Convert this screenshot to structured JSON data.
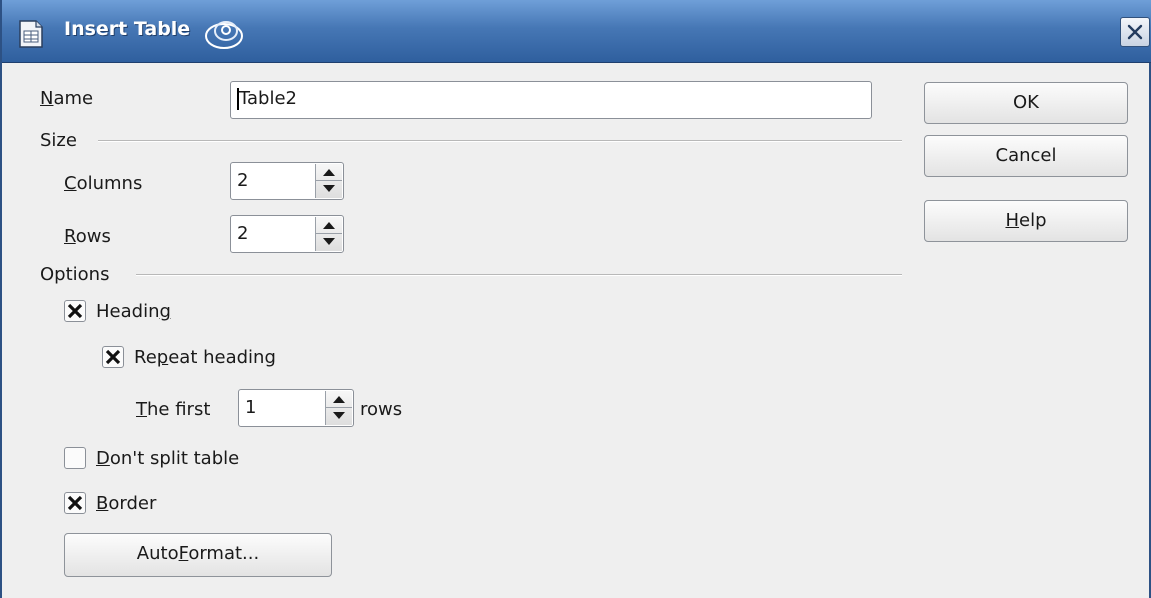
{
  "window": {
    "title": "Insert Table",
    "colors": {
      "titlebar": "#4677b5",
      "background": "#efefef"
    },
    "icons": [
      "table-document-icon",
      "swirl-icon",
      "close-icon"
    ]
  },
  "name_field": {
    "label_accel": "N",
    "label_rest": "ame",
    "value": "Table2"
  },
  "size_section": {
    "title": "Size",
    "columns": {
      "label_accel": "C",
      "label_rest": "olumns",
      "value": "2"
    },
    "rows": {
      "label_accel": "R",
      "label_rest": "ows",
      "value": "2"
    }
  },
  "options_section": {
    "title": "Options",
    "heading": {
      "label_pre": "Headin",
      "label_accel": "g",
      "checked": true
    },
    "repeat_heading": {
      "label_pre": "Re",
      "label_accel": "p",
      "label_post": "eat heading",
      "checked": true
    },
    "first_rows": {
      "label_accel": "T",
      "label_rest": "he first",
      "value": "1",
      "suffix": "rows"
    },
    "dont_split": {
      "label_accel": "D",
      "label_rest": "on't split table",
      "checked": false
    },
    "border": {
      "label_accel": "B",
      "label_rest": "order",
      "checked": true
    },
    "autoformat": {
      "label_pre": "Auto",
      "label_accel": "F",
      "label_post": "ormat..."
    }
  },
  "buttons": {
    "ok": "OK",
    "cancel": "Cancel",
    "help_accel": "H",
    "help_rest": "elp"
  }
}
